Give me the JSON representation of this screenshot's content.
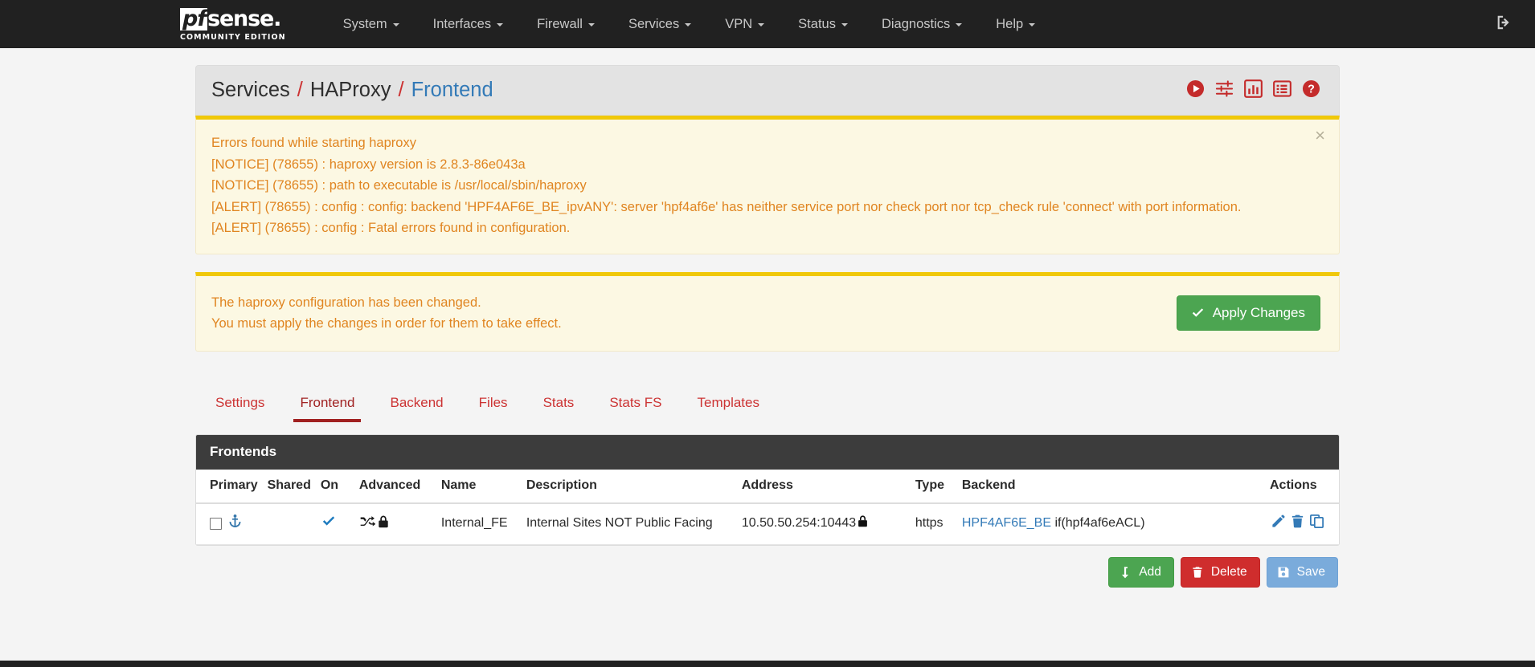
{
  "navbar": {
    "brand": {
      "pf": "pf",
      "sense": "sense.",
      "subtitle": "COMMUNITY EDITION"
    },
    "items": [
      {
        "label": "System",
        "icon": "chevron-down-icon"
      },
      {
        "label": "Interfaces",
        "icon": "chevron-down-icon"
      },
      {
        "label": "Firewall",
        "icon": "chevron-down-icon"
      },
      {
        "label": "Services",
        "icon": "chevron-down-icon"
      },
      {
        "label": "VPN",
        "icon": "chevron-down-icon"
      },
      {
        "label": "Status",
        "icon": "chevron-down-icon"
      },
      {
        "label": "Diagnostics",
        "icon": "chevron-down-icon"
      },
      {
        "label": "Help",
        "icon": "chevron-down-icon"
      }
    ],
    "logout_icon": "sign-out-icon"
  },
  "header": {
    "breadcrumb": {
      "root": "Services",
      "section": "HAProxy",
      "page": "Frontend",
      "separator": "/"
    },
    "icons": [
      {
        "name": "play-circle-icon",
        "title": "play-circle"
      },
      {
        "name": "sliders-icon",
        "title": "sliders"
      },
      {
        "name": "chart-bar-icon",
        "title": "chart-bar"
      },
      {
        "name": "list-alt-icon",
        "title": "list-alt"
      },
      {
        "name": "question-circle-icon",
        "title": "help"
      }
    ],
    "icon_color": "#c42b2b"
  },
  "alerts": {
    "error": {
      "lines": [
        "Errors found while starting haproxy",
        "[NOTICE] (78655) : haproxy version is 2.8.3-86e043a",
        "[NOTICE] (78655) : path to executable is /usr/local/sbin/haproxy",
        "[ALERT] (78655) : config : config: backend 'HPF4AF6E_BE_ipvANY': server 'hpf4af6e' has neither service port nor check port nor tcp_check rule 'connect' with port information.",
        "[ALERT] (78655) : config : Fatal errors found in configuration."
      ],
      "close_label": "×",
      "text_color": "#e08521",
      "bg_color": "#fcf8e3"
    },
    "changed": {
      "lines": [
        "The haproxy configuration has been changed.",
        "You must apply the changes in order for them to take effect."
      ],
      "apply_label": "Apply Changes",
      "apply_icon": "check-icon",
      "apply_color": "#4ca551"
    }
  },
  "tabs": [
    {
      "label": "Settings",
      "active": false
    },
    {
      "label": "Frontend",
      "active": true
    },
    {
      "label": "Backend",
      "active": false
    },
    {
      "label": "Files",
      "active": false
    },
    {
      "label": "Stats",
      "active": false
    },
    {
      "label": "Stats FS",
      "active": false
    },
    {
      "label": "Templates",
      "active": false
    }
  ],
  "panel": {
    "title": "Frontends",
    "columns": [
      "Primary",
      "Shared",
      "On",
      "Advanced",
      "Name",
      "Description",
      "Address",
      "Type",
      "Backend",
      "Actions"
    ],
    "rows": [
      {
        "primary_checkbox": false,
        "primary_icon": "anchor-icon",
        "shared": "",
        "on_icon": "check-icon",
        "advanced_icons": [
          "random-icon",
          "lock-icon"
        ],
        "name": "Internal_FE",
        "description": "Internal Sites NOT Public Facing",
        "address": "10.50.50.254:10443",
        "address_icon": "lock-icon",
        "type": "https",
        "backend_link": "HPF4AF6E_BE",
        "backend_condition": "if(hpf4af6eACL)",
        "actions": [
          "edit-icon",
          "delete-icon",
          "duplicate-icon"
        ]
      }
    ]
  },
  "footer_buttons": [
    {
      "label": "Add",
      "icon": "arrow-down-icon",
      "style": "add"
    },
    {
      "label": "Delete",
      "icon": "trash-icon",
      "style": "delete"
    },
    {
      "label": "Save",
      "icon": "floppy-disk-icon",
      "style": "save"
    }
  ]
}
